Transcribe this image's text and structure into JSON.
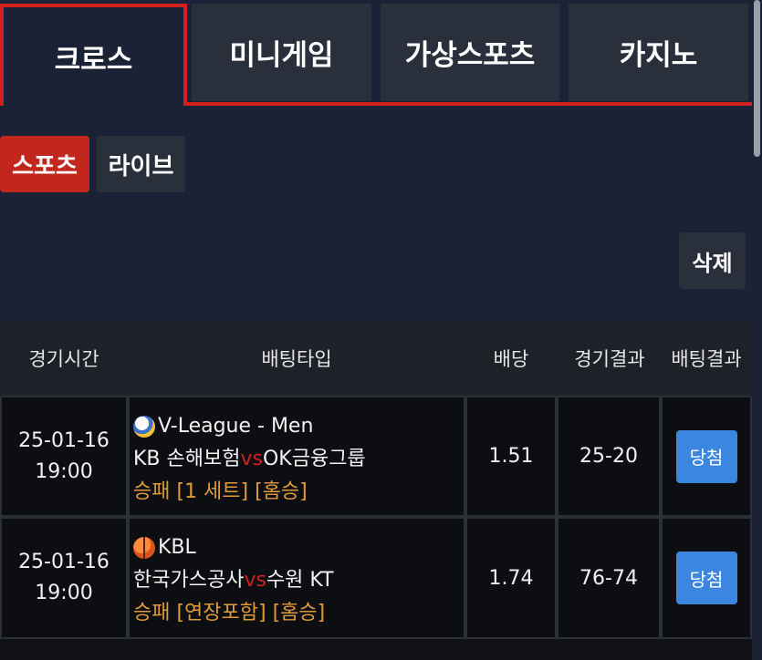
{
  "top_tabs": [
    {
      "label": "크로스",
      "active": true
    },
    {
      "label": "미니게임",
      "active": false
    },
    {
      "label": "가상스포츠",
      "active": false
    },
    {
      "label": "카지노",
      "active": false
    }
  ],
  "sub_tabs": [
    {
      "label": "스포츠",
      "active": true
    },
    {
      "label": "라이브",
      "active": false
    }
  ],
  "delete_label": "삭제",
  "table": {
    "headers": [
      "경기시간",
      "배팅타입",
      "배당",
      "경기결과",
      "배팅결과"
    ],
    "rows": [
      {
        "date": "25-01-16",
        "time": "19:00",
        "sport_icon": "volleyball-icon",
        "league": "V-League - Men",
        "home": "KB 손해보험",
        "vs": "vs",
        "away": "OK금융그룹",
        "market": "승패 [1 세트] [홈승]",
        "odds": "1.51",
        "score": "25-20",
        "result": "당첨"
      },
      {
        "date": "25-01-16",
        "time": "19:00",
        "sport_icon": "basketball-icon",
        "league": "KBL",
        "home": "한국가스공사",
        "vs": "vs",
        "away": "수원 KT",
        "market": "승패 [연장포함] [홈승]",
        "odds": "1.74",
        "score": "76-74",
        "result": "당첨"
      }
    ]
  },
  "colors": {
    "accent_red": "#d2201e",
    "win_blue": "#3a86e0",
    "market_orange": "#e09a3a",
    "background": "#1b2236"
  }
}
